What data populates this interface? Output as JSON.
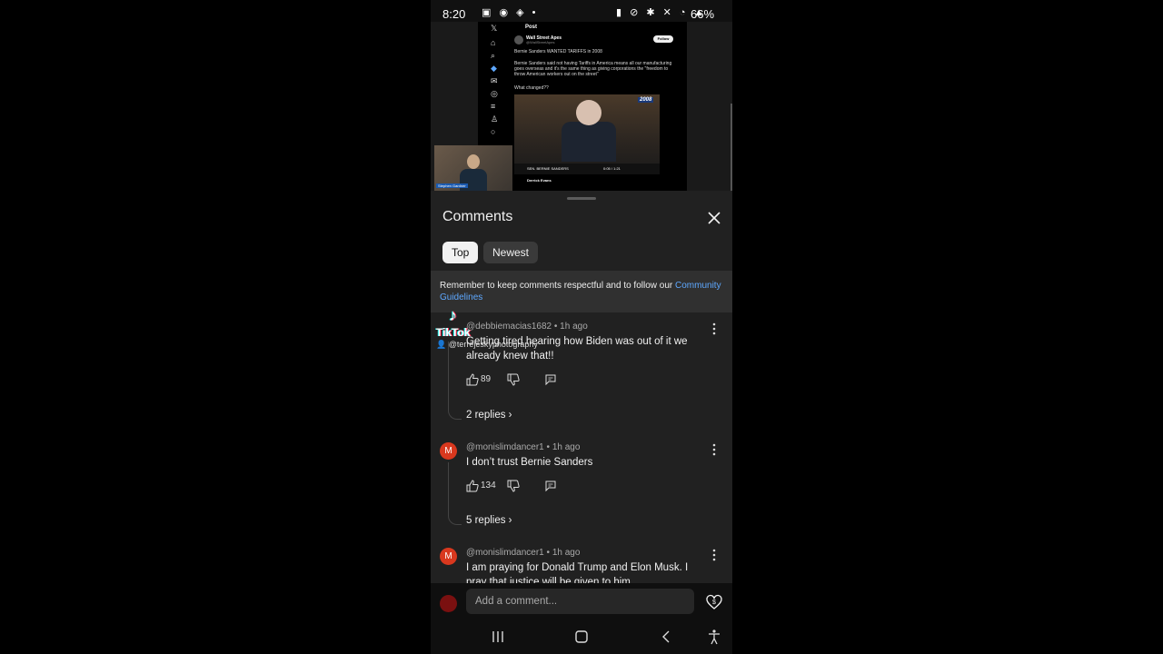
{
  "status_bar": {
    "time": "8:20",
    "battery": "66%",
    "left_icons": [
      "screenshot-icon",
      "notification-icon",
      "app-icon",
      "dot-icon"
    ],
    "right_icons": [
      "battery-saver-icon",
      "alarm-icon",
      "bluetooth-icon",
      "mute-icon",
      "wifi-icon",
      "signal-icon"
    ]
  },
  "video": {
    "post_header": "Post",
    "author": "Wall Street Apes",
    "handle": "@WallStreetApes",
    "follow": "Follow",
    "line1": "Bernie Sanders WANTED TARIFFS in 2008",
    "line2": "Bernie Sanders said not having Tariffs in America means all our manufacturing goes overseas and it's the same thing as giving corporations the \"freedom to throw American workers out on the street\"",
    "line3": "What changed??",
    "year": "2008",
    "lower_third": "SEN. BERNIE SANDERS",
    "time_display": "0:05 / 1:21",
    "reply_author": "Derrick Evans",
    "pip_name": "Stephen Gardner"
  },
  "sheet": {
    "title": "Comments",
    "tabs": [
      {
        "label": "Top",
        "active": true
      },
      {
        "label": "Newest",
        "active": false
      }
    ],
    "notice_text": "Remember to keep comments respectful and to follow our ",
    "notice_link": "Community Guidelines"
  },
  "comments": [
    {
      "author": "@debbiemacias1682",
      "time": "1h ago",
      "text": "Getting tired hearing how Biden was out of it we already knew that!!",
      "likes": "89",
      "replies": "2 replies",
      "avatar_letter": "",
      "avatar_color": "#3a3a3a"
    },
    {
      "author": "@monislimdancer1",
      "time": "1h ago",
      "text": "I don’t trust Bernie Sanders",
      "likes": "134",
      "replies": "5 replies",
      "avatar_letter": "M",
      "avatar_color": "#d9381e"
    },
    {
      "author": "@monislimdancer1",
      "time": "1h ago",
      "text": "I am praying for Donald Trump and Elon Musk. I pray that justice will be given to him",
      "avatar_letter": "M",
      "avatar_color": "#d9381e"
    }
  ],
  "watermark": {
    "brand": "TikTok",
    "user": "@terrejeskyphotography"
  },
  "add_comment": {
    "placeholder": "Add a comment..."
  },
  "colors": {
    "sheet_bg": "#212121",
    "link": "#5ea8ff",
    "accent_red": "#d9381e"
  }
}
